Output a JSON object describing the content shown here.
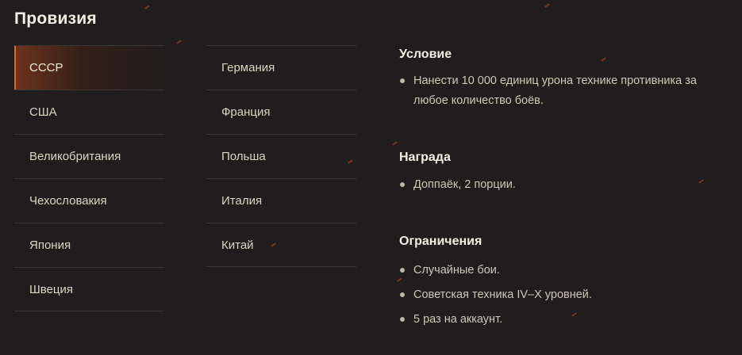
{
  "title": "Провизия",
  "nations": {
    "left": [
      "СССР",
      "США",
      "Великобритания",
      "Чехословакия",
      "Япония",
      "Швеция"
    ],
    "mid": [
      "Германия",
      "Франция",
      "Польша",
      "Италия",
      "Китай"
    ],
    "active": "СССР"
  },
  "condition": {
    "title": "Условие",
    "items": [
      "Нанести 10 000 единиц урона технике противника за любое количество боёв."
    ]
  },
  "reward": {
    "title": "Награда",
    "items": [
      "Доппаёк, 2 порции."
    ]
  },
  "limits": {
    "title": "Ограничения",
    "items": [
      "Случайные бои.",
      "Советская техника IV–X уровней.",
      "5 раз на аккаунт."
    ]
  },
  "colors": {
    "background": "#1f1d1d",
    "accent": "#e2682f",
    "text": "#e8e2d4"
  }
}
